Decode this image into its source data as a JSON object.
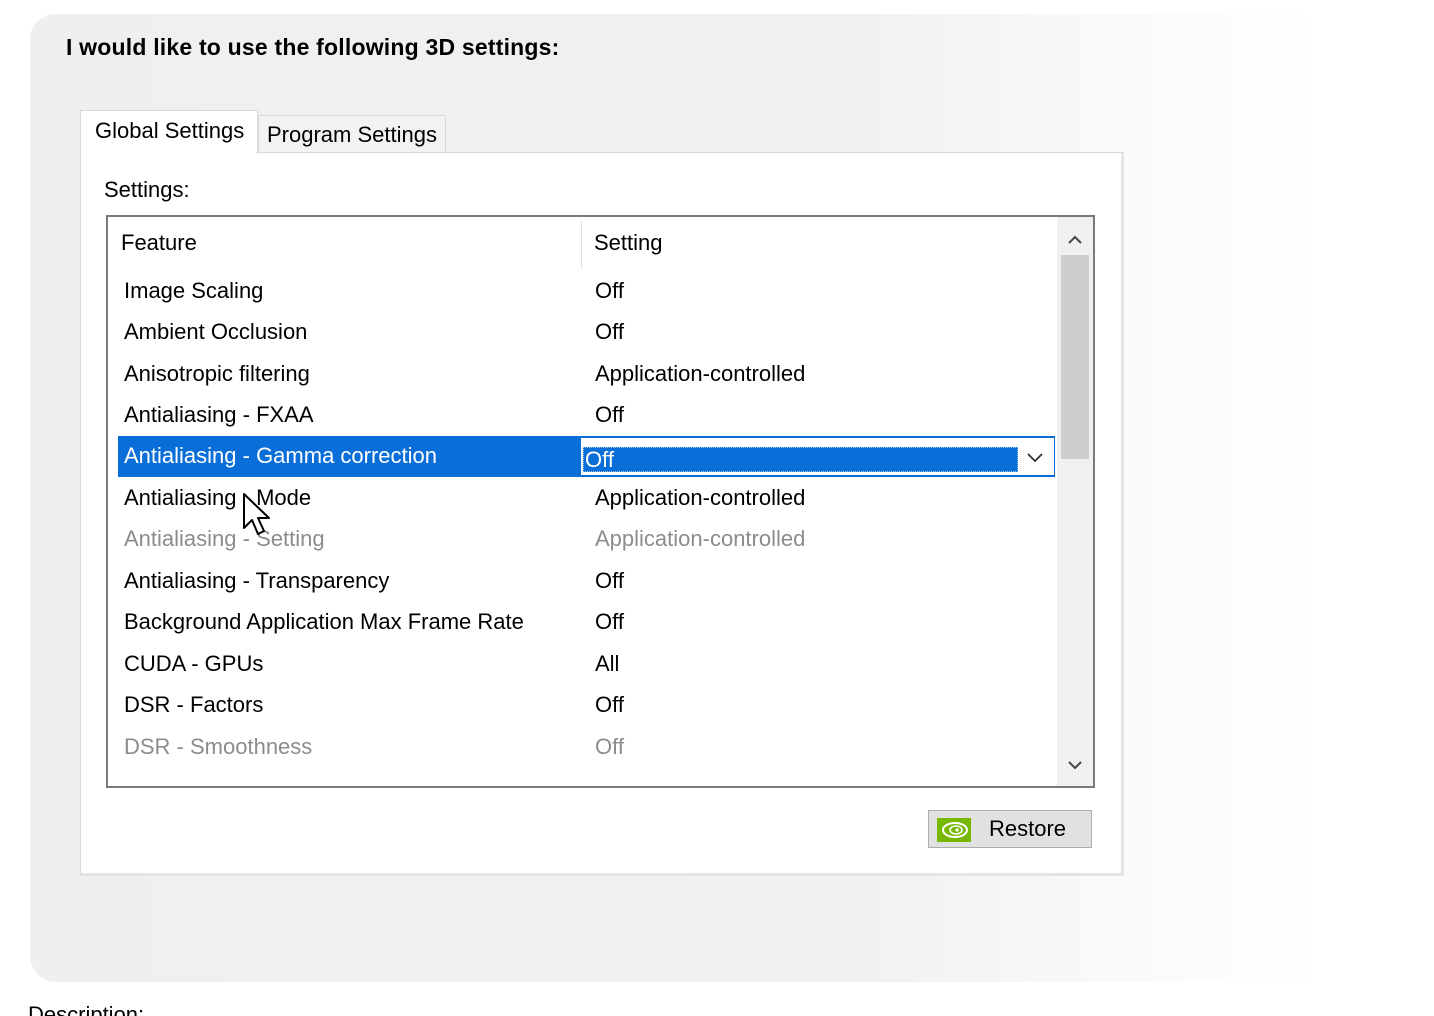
{
  "heading": "I would like to use the following 3D settings:",
  "tabs": [
    {
      "label": "Global Settings",
      "active": true
    },
    {
      "label": "Program Settings",
      "active": false
    }
  ],
  "settings_label": "Settings:",
  "table": {
    "columns": [
      "Feature",
      "Setting"
    ],
    "rows": [
      {
        "feature": "Image Scaling",
        "setting": "Off"
      },
      {
        "feature": "Ambient Occlusion",
        "setting": "Off"
      },
      {
        "feature": "Anisotropic filtering",
        "setting": "Application-controlled"
      },
      {
        "feature": "Antialiasing - FXAA",
        "setting": "Off"
      },
      {
        "feature": "Antialiasing - Gamma correction",
        "setting": "Off",
        "selected": true
      },
      {
        "feature": "Antialiasing - Mode",
        "setting": "Application-controlled"
      },
      {
        "feature": "Antialiasing - Setting",
        "setting": "Application-controlled",
        "disabled": true
      },
      {
        "feature": "Antialiasing - Transparency",
        "setting": "Off"
      },
      {
        "feature": "Background Application Max Frame Rate",
        "setting": "Off"
      },
      {
        "feature": "CUDA - GPUs",
        "setting": "All"
      },
      {
        "feature": "DSR - Factors",
        "setting": "Off"
      },
      {
        "feature": "DSR - Smoothness",
        "setting": "Off",
        "disabled": true
      }
    ]
  },
  "restore_button": {
    "label": "Restore",
    "icon": "nvidia-logo-icon"
  },
  "description_label": "Description:",
  "colors": {
    "selection": "#0a6ed8",
    "disabled_text": "#8c8c8c",
    "nvidia_green": "#76b900"
  }
}
